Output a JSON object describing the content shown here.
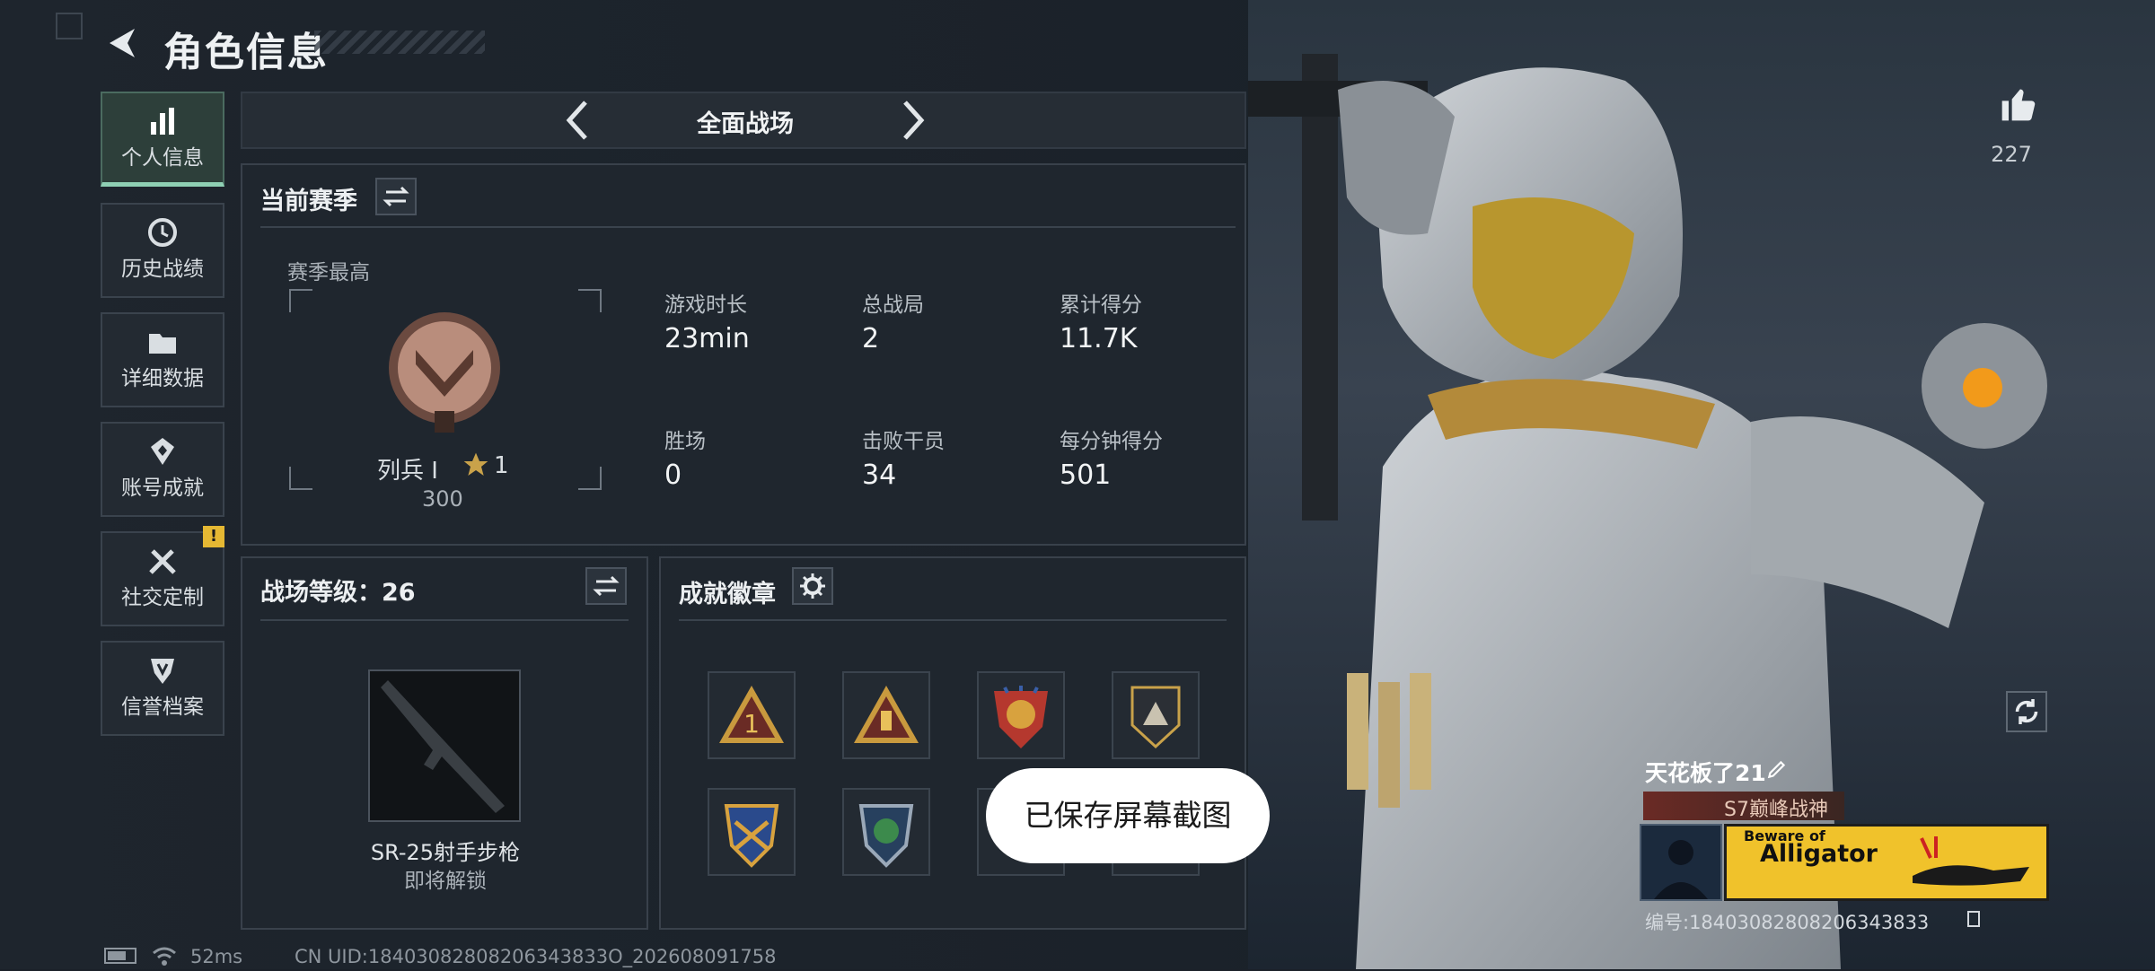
{
  "header": {
    "title": "角色信息"
  },
  "sidebar": {
    "items": [
      {
        "label": "个人信息",
        "icon": "bar-chart-icon",
        "active": true
      },
      {
        "label": "历史战绩",
        "icon": "history-clock-icon"
      },
      {
        "label": "详细数据",
        "icon": "folder-icon"
      },
      {
        "label": "账号成就",
        "icon": "achievement-icon"
      },
      {
        "label": "社交定制",
        "icon": "tools-icon"
      },
      {
        "label": "信誉档案",
        "icon": "shield-emblem-icon"
      }
    ],
    "warning_badge": "!"
  },
  "mode": {
    "title": "全面战场"
  },
  "season": {
    "title": "当前赛季",
    "best_label": "赛季最高",
    "rank_name": "列兵 I",
    "star_count": "1",
    "rank_points": "300",
    "stats": [
      {
        "label": "游戏时长",
        "value": "23min"
      },
      {
        "label": "总战局",
        "value": "2"
      },
      {
        "label": "累计得分",
        "value": "11.7K"
      },
      {
        "label": "胜场",
        "value": "0"
      },
      {
        "label": "击败干员",
        "value": "34"
      },
      {
        "label": "每分钟得分",
        "value": "501"
      }
    ]
  },
  "battlefield": {
    "title": "战场等级：26",
    "weapon_name": "SR-25射手步枪",
    "weapon_status": "即将解锁"
  },
  "achievements": {
    "title": "成就徽章"
  },
  "toast": {
    "text": "已保存屏幕截图"
  },
  "character": {
    "like_count": "227",
    "player_name": "天花板了21",
    "title_tag": "S7巅峰战神",
    "banner_line1": "Beware of",
    "banner_line2": "Alligator",
    "uid_line": "编号:18403082808206343833"
  },
  "status_bar": {
    "ping": "52ms",
    "uid": "CN UID:18403082808206343833O_202608091758"
  },
  "colors": {
    "accent": "#8fd0b4",
    "warning": "#e5b833",
    "banner": "#f0c22b"
  }
}
